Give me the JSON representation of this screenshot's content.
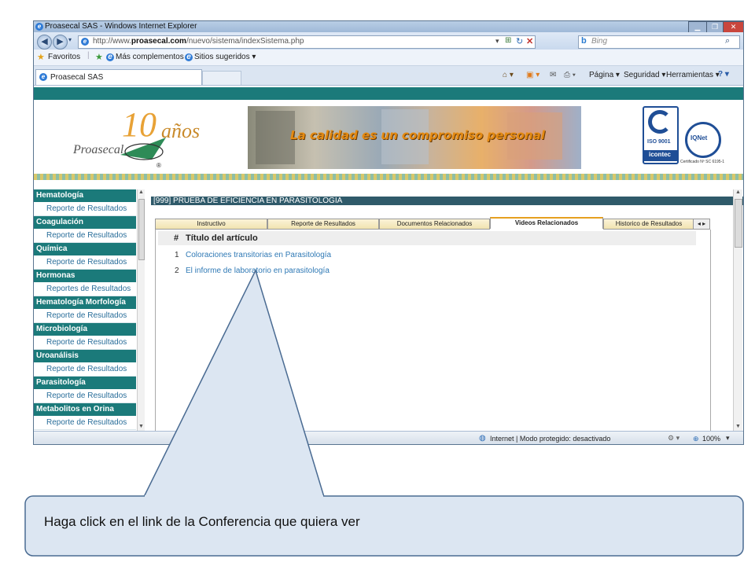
{
  "browser": {
    "title": "Proasecal SAS - Windows Internet Explorer",
    "url_prefix": "http://www.",
    "url_domain": "proasecal.com",
    "url_path": "/nuevo/sistema/indexSistema.php",
    "search_engine": "Bing",
    "favorites_label": "Favoritos",
    "more_addons": "Más complementos ▾",
    "suggested_sites": "Sitios sugeridos ▾",
    "tab_title": "Proasecal SAS",
    "cmd_page": "Página ▾",
    "cmd_security": "Seguridad ▾",
    "cmd_tools": "Herramientas ▾",
    "status_zone": "Internet | Modo protegido: desactivado",
    "zoom": "100%"
  },
  "banner": {
    "logo_text": "Proasecal",
    "logo_years": "años",
    "logo_number": "10",
    "slogan": "La calidad es un compromiso personal",
    "iso_label": "ISO 9001",
    "icontec_label": "icontec",
    "inet_label": "IQNet",
    "certificate": "Certificado Nº SC 6195-1",
    "registered": "®"
  },
  "sidebar": [
    {
      "section": "Hematología",
      "link": "Reporte de Resultados"
    },
    {
      "section": "Coagulación",
      "link": "Reporte de Resultados"
    },
    {
      "section": "Química",
      "link": "Reporte de Resultados"
    },
    {
      "section": "Hormonas",
      "link": "Reportes de Resultados"
    },
    {
      "section": "Hematología Morfología",
      "link": "Reporte de Resultados"
    },
    {
      "section": "Microbiología",
      "link": "Reporte de Resultados"
    },
    {
      "section": "Uroanálisis",
      "link": "Reporte de Resultados"
    },
    {
      "section": "Parasitología",
      "link": "Reporte de Resultados"
    },
    {
      "section": "Metabolitos en Orina",
      "link": "Reporte de Resultados"
    }
  ],
  "main": {
    "course_title": "[999] PRUEBA DE EFICIENCIA EN PARASITOLOGIA",
    "tabs": [
      "Instructivo",
      "Reporte de Resultados",
      "Documentos Relacionados",
      "Videos Relacionados",
      "Historico de Resultados"
    ],
    "active_tab": "Videos Relacionados",
    "table_header_num": "#",
    "table_header_title": "Título del artículo",
    "articles": [
      {
        "num": "1",
        "title": "Coloraciones transitorias en Parasitología"
      },
      {
        "num": "2",
        "title": "El informe de laboratorio en parasitología"
      }
    ]
  },
  "callout": {
    "text": "Haga click en el link de la Conferencia que quiera ver",
    "fill": "#dce6f2",
    "stroke": "#4a6b92"
  }
}
